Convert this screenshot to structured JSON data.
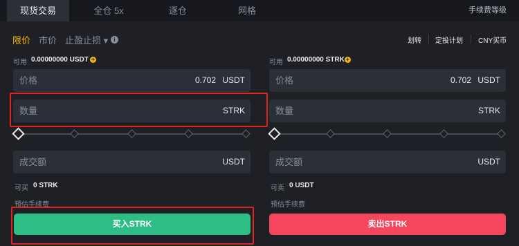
{
  "tabs": [
    "现货交易",
    "全仓 5x",
    "逐仓",
    "网格"
  ],
  "fee_link": "手续费等级",
  "order_types": [
    "限价",
    "市价",
    "止盈止损 ▾"
  ],
  "right_links": [
    "划转",
    "定投计划",
    "CNY买币"
  ],
  "buy": {
    "avail_label": "可用",
    "avail_value": "0.00000000 USDT",
    "price_label": "价格",
    "price_value": "0.702",
    "price_unit": "USDT",
    "qty_label": "数量",
    "qty_unit": "STRK",
    "total_label": "成交额",
    "total_unit": "USDT",
    "max_label": "可买",
    "max_value": "0 STRK",
    "fee_label": "预估手续费",
    "button": "买入STRK"
  },
  "sell": {
    "avail_label": "可用",
    "avail_value": "0.00000000 STRK",
    "price_label": "价格",
    "price_value": "0.702",
    "price_unit": "USDT",
    "qty_label": "数量",
    "qty_unit": "STRK",
    "total_label": "成交额",
    "total_unit": "USDT",
    "max_label": "可卖",
    "max_value": "0 USDT",
    "fee_label": "预估手续费",
    "button": "卖出STRK"
  },
  "colors": {
    "accent": "#f0b90b",
    "buy": "#2ebd85",
    "sell": "#f6465d",
    "highlight": "#e02424"
  }
}
